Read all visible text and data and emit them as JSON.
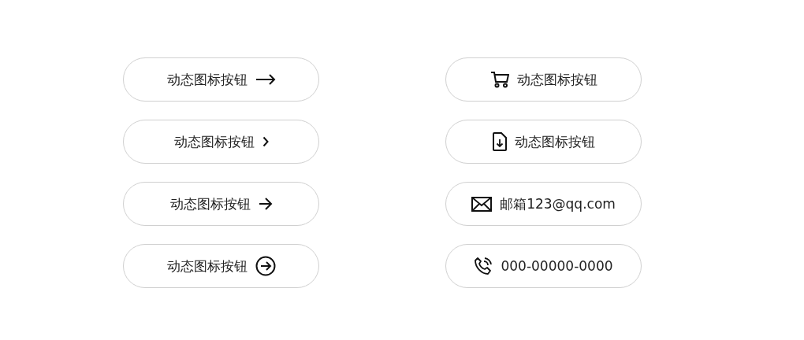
{
  "columns": [
    {
      "buttons": [
        {
          "label": "动态图标按钮"
        },
        {
          "label": "动态图标按钮"
        },
        {
          "label": "动态图标按钮"
        },
        {
          "label": "动态图标按钮"
        }
      ]
    },
    {
      "buttons": [
        {
          "label": "动态图标按钮"
        },
        {
          "label": "动态图标按钮"
        },
        {
          "label": "邮箱123@qq.com"
        },
        {
          "label": "000-00000-0000"
        }
      ]
    }
  ]
}
